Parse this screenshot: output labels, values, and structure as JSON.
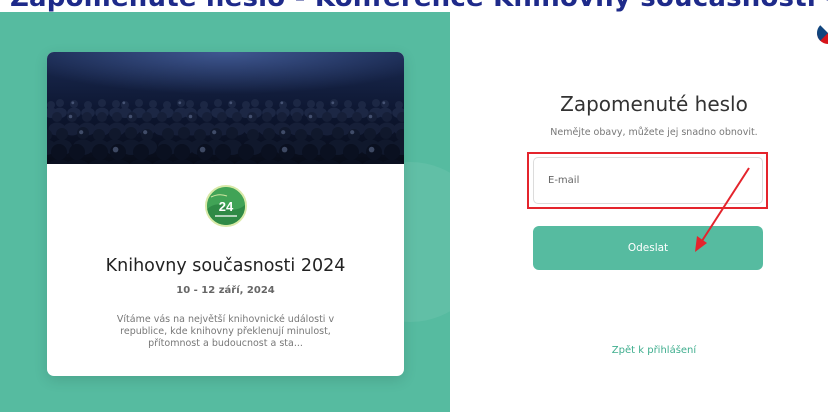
{
  "header": {
    "clipped_heading": "Zapomenuté heslo - Konference Knihovny současnosti - Kalendar application"
  },
  "event_card": {
    "logo_number": "24",
    "title": "Knihovny současnosti 2024",
    "date": "10 - 12 září, 2024",
    "description": "Vítáme vás na největší knihovnické události v republice, kde knihovny překlenují minulost, přítomnost a budoucnost a sta..."
  },
  "form": {
    "title": "Zapomenuté heslo",
    "subtitle": "Nemějte obavy, můžete jej snadno obnovit.",
    "email_placeholder": "E-mail",
    "email_value": "",
    "submit_label": "Odeslat",
    "back_link": "Zpět k přihlášení"
  },
  "language": {
    "icon": "czech-flag-icon"
  },
  "colors": {
    "brand_green": "#56bba0",
    "link_green": "#3fae8e",
    "annotation_red": "#e4242c",
    "heading_blue": "#1e2a8a"
  }
}
